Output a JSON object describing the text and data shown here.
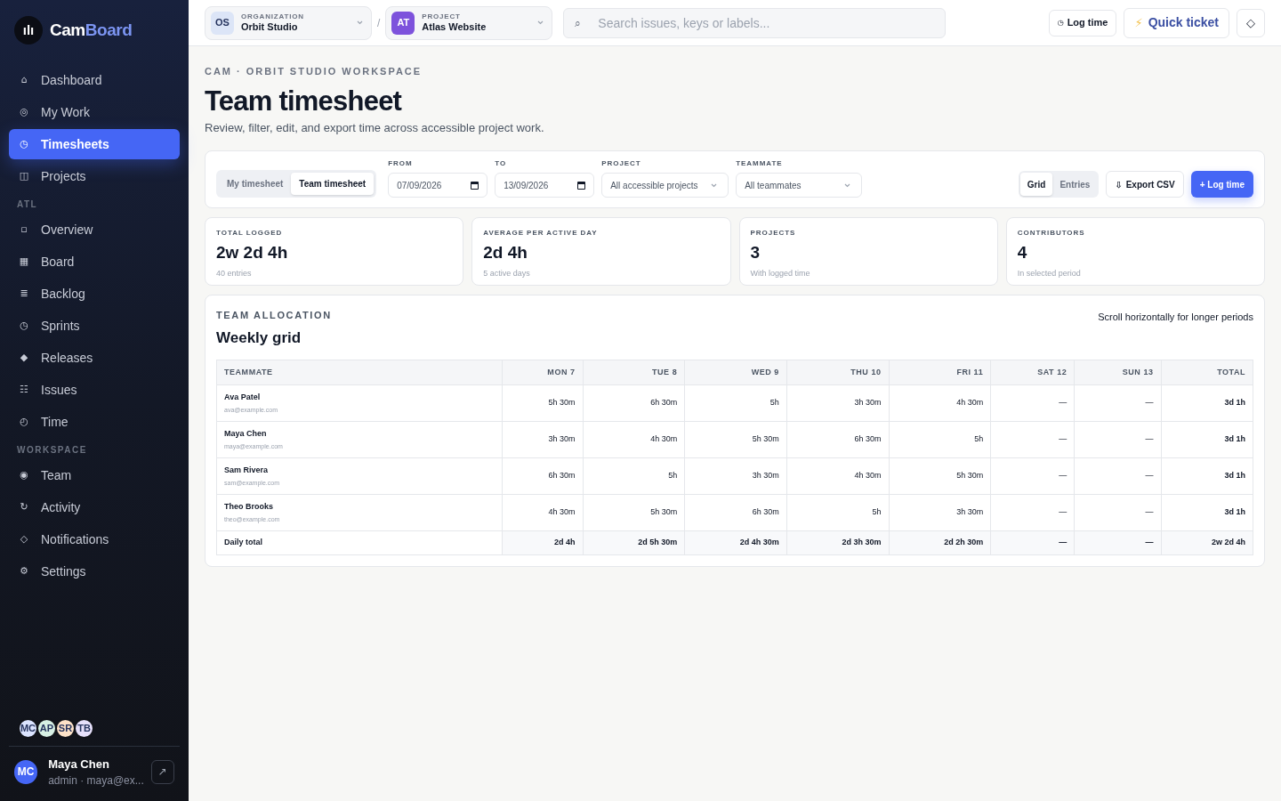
{
  "brand": {
    "logo": "ılı",
    "name_a": "Cam",
    "name_b": "Board"
  },
  "sidebar": {
    "sections": [
      {
        "items": [
          {
            "icon": "⌂",
            "label": "Dashboard",
            "selected": false
          },
          {
            "icon": "◎",
            "label": "My Work",
            "selected": false
          },
          {
            "icon": "◷",
            "label": "Timesheets",
            "selected": true
          },
          {
            "icon": "◫",
            "label": "Projects",
            "selected": false
          }
        ]
      },
      {
        "heading": "ATL",
        "items": [
          {
            "icon": "▫",
            "label": "Overview",
            "selected": false
          },
          {
            "icon": "▦",
            "label": "Board",
            "selected": false
          },
          {
            "icon": "≣",
            "label": "Backlog",
            "selected": false
          },
          {
            "icon": "◷",
            "label": "Sprints",
            "selected": false
          },
          {
            "icon": "◆",
            "label": "Releases",
            "selected": false
          },
          {
            "icon": "☷",
            "label": "Issues",
            "selected": false
          },
          {
            "icon": "◴",
            "label": "Time",
            "selected": false
          }
        ]
      },
      {
        "heading": "WORKSPACE",
        "items": [
          {
            "icon": "◉",
            "label": "Team",
            "selected": false
          },
          {
            "icon": "↻",
            "label": "Activity",
            "selected": false
          },
          {
            "icon": "◇",
            "label": "Notifications",
            "selected": false
          },
          {
            "icon": "⚙",
            "label": "Settings",
            "selected": false
          }
        ]
      }
    ],
    "avatars": [
      {
        "initials": "MC",
        "color": "#dbe4ff"
      },
      {
        "initials": "AP",
        "color": "#d7f0e4"
      },
      {
        "initials": "SR",
        "color": "#fde2c8"
      },
      {
        "initials": "TB",
        "color": "#e6e0fb"
      }
    ],
    "user": {
      "initials": "MC",
      "name": "Maya Chen",
      "meta": "admin · maya@ex...",
      "action": "↗"
    }
  },
  "topbar": {
    "organization": {
      "badge": "OS",
      "label": "ORGANIZATION",
      "value": "Orbit Studio"
    },
    "separator": "/",
    "project": {
      "badge": "AT",
      "label": "PROJECT",
      "value": "Atlas Website"
    },
    "search": {
      "icon": "⌕",
      "placeholder": "Search issues, keys or labels..."
    },
    "log_time": {
      "icon": "◷",
      "label": "Log time"
    },
    "quick_ticket": {
      "icon": "⚡",
      "label": "Quick ticket"
    },
    "notifications": "◇"
  },
  "page": {
    "eyebrow": "CAM · ORBIT STUDIO WORKSPACE",
    "title": "Team timesheet",
    "subtitle": "Review, filter, edit, and export time across accessible project work."
  },
  "filters": {
    "modes": [
      {
        "label": "My timesheet",
        "selected": false
      },
      {
        "label": "Team timesheet",
        "selected": true
      }
    ],
    "from": {
      "label": "FROM",
      "value": "07/09/2026"
    },
    "to": {
      "label": "TO",
      "value": "13/09/2026"
    },
    "project": {
      "label": "PROJECT",
      "value": "All accessible projects"
    },
    "teammate": {
      "label": "TEAMMATE",
      "value": "All teammates"
    },
    "views": [
      {
        "label": "Grid",
        "selected": true
      },
      {
        "label": "Entries",
        "selected": false
      }
    ],
    "export": {
      "icon": "⇩",
      "label": "Export CSV"
    },
    "log_time": "+ Log time"
  },
  "stats": [
    {
      "label": "TOTAL LOGGED",
      "value": "2w 2d 4h",
      "note": "40 entries"
    },
    {
      "label": "AVERAGE PER ACTIVE DAY",
      "value": "2d 4h",
      "note": "5 active days"
    },
    {
      "label": "PROJECTS",
      "value": "3",
      "note": "With logged time"
    },
    {
      "label": "CONTRIBUTORS",
      "value": "4",
      "note": "In selected period"
    }
  ],
  "grid": {
    "eyebrow": "TEAM ALLOCATION",
    "title": "Weekly grid",
    "hint": "Scroll horizontally for longer periods",
    "teammate_column": "TEAMMATE",
    "day_columns": [
      "MON 7",
      "TUE 8",
      "WED 9",
      "THU 10",
      "FRI 11",
      "SAT 12",
      "SUN 13"
    ],
    "total_column": "TOTAL",
    "rows": [
      {
        "name": "Ava Patel",
        "email": "ava@example.com",
        "cells": [
          "5h 30m",
          "6h 30m",
          "5h",
          "3h 30m",
          "4h 30m",
          "—",
          "—"
        ],
        "total": "3d 1h"
      },
      {
        "name": "Maya Chen",
        "email": "maya@example.com",
        "cells": [
          "3h 30m",
          "4h 30m",
          "5h 30m",
          "6h 30m",
          "5h",
          "—",
          "—"
        ],
        "total": "3d 1h"
      },
      {
        "name": "Sam Rivera",
        "email": "sam@example.com",
        "cells": [
          "6h 30m",
          "5h",
          "3h 30m",
          "4h 30m",
          "5h 30m",
          "—",
          "—"
        ],
        "total": "3d 1h"
      },
      {
        "name": "Theo Brooks",
        "email": "theo@example.com",
        "cells": [
          "4h 30m",
          "5h 30m",
          "6h 30m",
          "5h",
          "3h 30m",
          "—",
          "—"
        ],
        "total": "3d 1h"
      }
    ],
    "footer": {
      "label": "Daily total",
      "cells": [
        "2d 4h",
        "2d 5h 30m",
        "2d 4h 30m",
        "2d 3h 30m",
        "2d 2h 30m",
        "—",
        "—"
      ],
      "total": "2w 2d 4h"
    }
  }
}
